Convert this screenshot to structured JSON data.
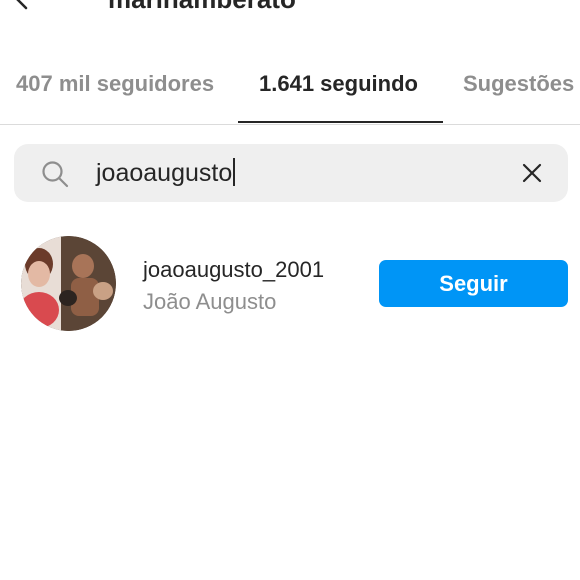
{
  "header": {
    "username": "marinamberato"
  },
  "tabs": [
    {
      "label": "407 mil seguidores",
      "active": false
    },
    {
      "label": "1.641 seguindo",
      "active": true
    },
    {
      "label": "Sugestões",
      "active": false
    }
  ],
  "search": {
    "value": "joaoaugusto",
    "icon": "search-icon",
    "clear_icon": "close-icon"
  },
  "results": [
    {
      "username": "joaoaugusto_2001",
      "full_name": "João Augusto",
      "button_label": "Seguir"
    }
  ],
  "colors": {
    "accent": "#0095f6",
    "text_primary": "#262626",
    "text_secondary": "#8e8e8e",
    "search_bg": "#efefef"
  }
}
